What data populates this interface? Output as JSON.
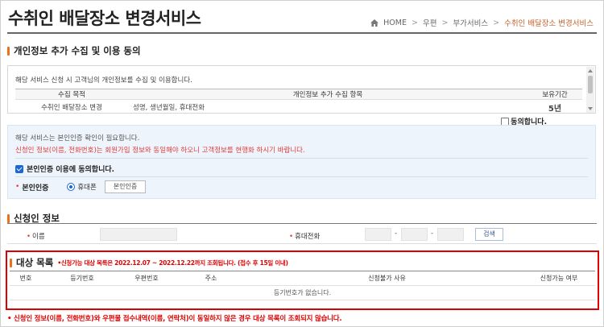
{
  "header": {
    "title": "수취인 배달장소 변경서비스",
    "breadcrumb": {
      "home": "HOME",
      "sep1": ">",
      "item1": "우편",
      "sep2": ">",
      "item2": "부가서비스",
      "sep3": ">",
      "current": "수취인 배달장소 변경서비스"
    }
  },
  "privacy": {
    "heading": "개인정보 추가 수집 및 이용 동의",
    "intro": "해당 서비스 신청 시 고객님의 개인정보를 수집 및 이용합니다.",
    "columns": [
      "수집 목적",
      "개인정보 추가 수집 항목",
      "보유기간"
    ],
    "rows": [
      {
        "purpose": "수취인 배달장소 변경",
        "items": "성명, 생년월일, 휴대전화",
        "period": "5년"
      }
    ],
    "agree_label": "동의합니다."
  },
  "auth": {
    "notice1": "해당 서비스는 본인인증 확인이 필요합니다.",
    "notice2": "신청인 정보(이름, 전화번호)는 회원가입 정보와 동일해야 하오니 고객정보를 현행화 하시기 바랍니다.",
    "consent_label": "본인인증 이용에 동의합니다.",
    "required_mark": "•",
    "method_label": "본인인증",
    "radio_label": "휴대폰",
    "button_label": "본인인증"
  },
  "applicant": {
    "heading": "신청인 정보",
    "required_mark": "•",
    "name_label": "이름",
    "phone_label": "휴대전화",
    "dash": "-",
    "search_label": "검색"
  },
  "target": {
    "heading": "대상 목록",
    "note": "•신청가능 대상 목록은 2022.12.07 ~ 2022.12.22까지 조회됩니다. (접수 후 15일 이내)",
    "columns": [
      "번호",
      "등기번호",
      "우편번호",
      "주소",
      "신청불가 사유",
      "신청가능 여부"
    ],
    "empty_message": "등기번호가 없습니다."
  },
  "footer_note": "• 신청인 정보(이름, 전화번호)와 우편물 접수내역(이름, 연락처)이 동일하지 않은 경우 대상 목록이 조회되지 않습니다.",
  "colors": {
    "accent": "#e8731f",
    "alert_red": "#e00000",
    "info_blue": "#1a66d6",
    "auth_bg": "#eef4fb"
  }
}
